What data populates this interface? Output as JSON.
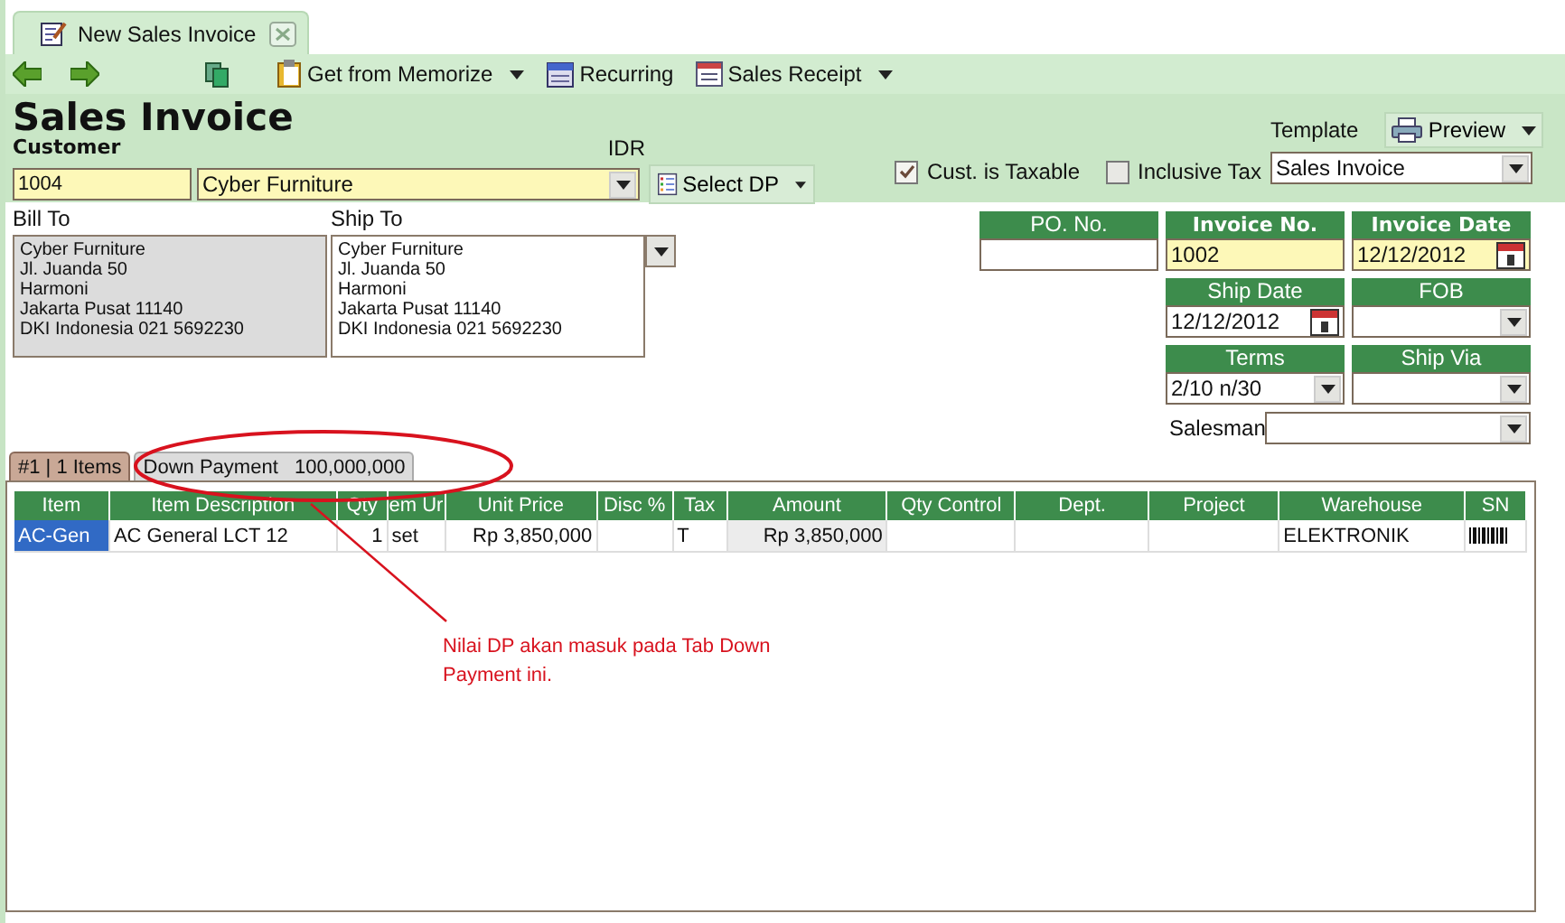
{
  "document_tab": {
    "title": "New Sales Invoice"
  },
  "toolbar": {
    "buttons": [
      {
        "kind": "memorize",
        "label": "Get from Memorize",
        "dropdown": true
      },
      {
        "kind": "recurring",
        "label": "Recurring",
        "dropdown": false
      },
      {
        "kind": "receipt",
        "label": "Sales Receipt",
        "dropdown": true
      }
    ]
  },
  "header": {
    "title": "Sales Invoice",
    "customer_label": "Customer",
    "currency": "IDR",
    "customer_id": "1004",
    "customer_name": "Cyber Furniture",
    "select_dp_button": "Select DP",
    "checkboxes": [
      {
        "label": "Cust. is Taxable",
        "checked": true
      },
      {
        "label": "Inclusive Tax",
        "checked": false
      }
    ],
    "template_label": "Template",
    "preview_button": "Preview",
    "template": "Sales Invoice"
  },
  "bill_to": {
    "label": "Bill To",
    "lines": [
      "Cyber Furniture",
      "Jl. Juanda 50",
      "Harmoni",
      "Jakarta Pusat 11140",
      "DKI Indonesia 021 5692230"
    ]
  },
  "ship_to": {
    "label": "Ship To",
    "lines": [
      "Cyber Furniture",
      "Jl. Juanda 50",
      "Harmoni",
      "Jakarta Pusat 11140",
      "DKI Indonesia 021 5692230"
    ]
  },
  "fields": [
    {
      "label": "PO. No.",
      "kind": "text",
      "required": false
    },
    {
      "label": "Invoice No.",
      "kind": "text",
      "required": true,
      "value": "1002"
    },
    {
      "label": "Invoice Date",
      "kind": "date",
      "required": true,
      "value": "12/12/2012"
    },
    {
      "label": "Ship Date",
      "kind": "date",
      "required": false,
      "value": "12/12/2012"
    },
    {
      "label": "FOB",
      "kind": "dropdown",
      "required": false
    },
    {
      "label": "Terms",
      "kind": "dropdown",
      "required": false,
      "value": "2/10 n/30"
    },
    {
      "label": "Ship Via",
      "kind": "dropdown",
      "required": false
    }
  ],
  "salesman": {
    "label": "Salesman"
  },
  "tabs": [
    {
      "label": "#1 | 1 Items",
      "selected": true
    },
    {
      "label": "Down Payment   100,000,000",
      "selected": false
    }
  ],
  "table": {
    "columns": [
      {
        "label": "Item",
        "kind": "text"
      },
      {
        "label": "Item Description",
        "kind": "text"
      },
      {
        "label": "Qty",
        "kind": "number"
      },
      {
        "label": "em Ur",
        "kind": "text"
      },
      {
        "label": "Unit Price",
        "kind": "number"
      },
      {
        "label": "Disc %",
        "kind": "text"
      },
      {
        "label": "Tax",
        "kind": "text"
      },
      {
        "label": "Amount",
        "kind": "computed"
      },
      {
        "label": "Qty Control",
        "kind": "text"
      },
      {
        "label": "Dept.",
        "kind": "text"
      },
      {
        "label": "Project",
        "kind": "text"
      },
      {
        "label": "Warehouse",
        "kind": "text"
      },
      {
        "label": "SN",
        "kind": "serial"
      }
    ],
    "rows": [
      {
        "cells": [
          {
            "text": "AC-Gen",
            "selected": true
          },
          {
            "text": "AC General LCT 12",
            "selected": false
          },
          {
            "text": "1",
            "selected": false
          },
          {
            "text": "set",
            "selected": false
          },
          {
            "text": "Rp 3,850,000",
            "selected": false
          },
          {
            "selected": false
          },
          {
            "text": "T",
            "selected": false
          },
          {
            "text": "Rp 3,850,000",
            "selected": false
          },
          {
            "selected": false
          },
          {
            "selected": false
          },
          {
            "selected": false
          },
          {
            "text": "ELEKTRONIK",
            "selected": false
          },
          {
            "selected": false
          }
        ]
      }
    ]
  },
  "annotation": {
    "note": "Nilai DP akan masuk pada Tab Down Payment ini."
  }
}
